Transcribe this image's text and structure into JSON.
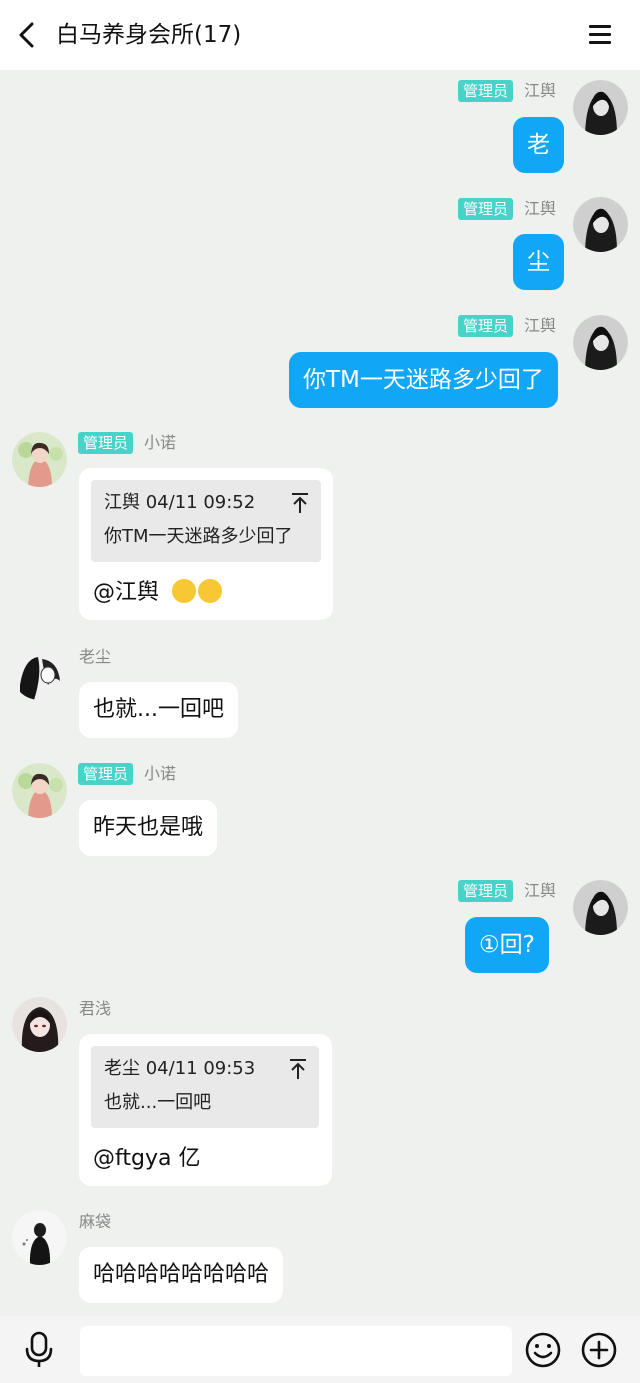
{
  "header": {
    "title": "白马养身会所(17)"
  },
  "admin_badge": "管理员",
  "messages": [
    {
      "sender": "江舆",
      "text": "老"
    },
    {
      "sender": "江舆",
      "text": "尘"
    },
    {
      "sender": "江舆",
      "text": "你TM一天迷路多少回了"
    },
    {
      "sender": "小诺",
      "quote_head": "江舆 04/11 09:52",
      "quote_text": "你TM一天迷路多少回了",
      "text": "@江舆"
    },
    {
      "sender": "老尘",
      "text": "也就...一回吧"
    },
    {
      "sender": "小诺",
      "text": "昨天也是哦"
    },
    {
      "sender": "江舆",
      "text": "①回?"
    },
    {
      "sender": "君浅",
      "quote_head": "老尘 04/11 09:53",
      "quote_text": "也就...一回吧",
      "text": "@ftgya 亿"
    },
    {
      "sender": "麻袋",
      "text": "哈哈哈哈哈哈哈哈"
    }
  ],
  "icons": {
    "back": "chevron-left-icon",
    "menu": "menu-icon",
    "pin": "pin-top-icon",
    "mic": "microphone-icon",
    "emoji": "emoji-icon",
    "plus": "plus-icon"
  },
  "colors": {
    "outgoing_bubble": "#12a7f6",
    "admin_badge": "#47d3ca",
    "background": "#eef1ee"
  }
}
